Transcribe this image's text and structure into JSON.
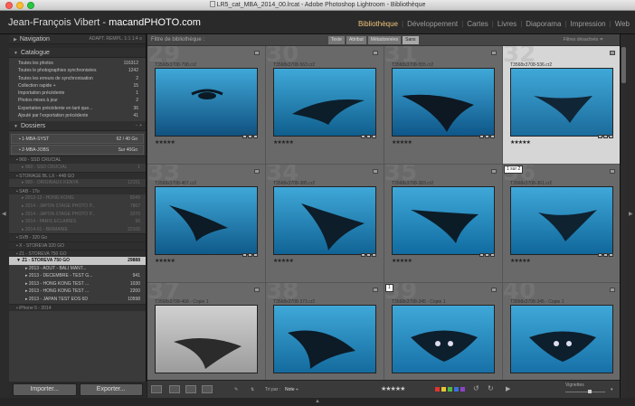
{
  "window": {
    "title": "LR5_cat_MBA_2014_00.lrcat - Adobe Photoshop Lightroom - Bibliothèque"
  },
  "identity": {
    "name": "Jean-François Vibert - ",
    "site": "macandPHOTO.com"
  },
  "modules": [
    {
      "label": "Bibliothèque",
      "active": true
    },
    {
      "label": "Développement"
    },
    {
      "label": "Cartes"
    },
    {
      "label": "Livres"
    },
    {
      "label": "Diaporama"
    },
    {
      "label": "Impression"
    },
    {
      "label": "Web"
    }
  ],
  "navigator": {
    "title": "Navigation",
    "options": "ADAPT.   REMPL.   1:1   1:4 ≡"
  },
  "catalog": {
    "title": "Catalogue",
    "items": [
      {
        "label": "Toutes les photos",
        "count": "116312"
      },
      {
        "label": "Toutes le photographies synchronisées",
        "count": "1242"
      },
      {
        "label": "Toutes les erreurs de synchronisation",
        "count": "2"
      },
      {
        "label": "Collection rapide +",
        "count": "15"
      },
      {
        "label": "Importation précédente",
        "count": "1"
      },
      {
        "label": "Photos mises à jour",
        "count": "2"
      },
      {
        "label": "Exportation précédente en tant que...",
        "count": "36"
      },
      {
        "label": "Ajouté par l'exportation précédente",
        "count": "41"
      }
    ]
  },
  "folders": {
    "title": "Dossiers",
    "rows": [
      {
        "label": "1-MBA-SYST",
        "count": "62 / 40 Go",
        "kind": "vol2"
      },
      {
        "label": "2-MBA-JOBS",
        "count": "Sur 40Go",
        "kind": "vol2"
      },
      {
        "label": "960 - SSD CRUCIAL",
        "count": "",
        "kind": "vol"
      },
      {
        "label": "960 - SSD CRUCIAL",
        "count": "1",
        "kind": "sub"
      },
      {
        "label": "STORAGE BL LX - 448 GO",
        "count": "",
        "kind": "vol"
      },
      {
        "label": "900 - ORIGINAUX KENYA",
        "count": "12151",
        "kind": "sub"
      },
      {
        "label": "SAB - 1To",
        "count": "",
        "kind": "vol"
      },
      {
        "label": "2013-12 - HONG KONG",
        "count": "8049",
        "kind": "sub"
      },
      {
        "label": "2014 - JAPON STAGE PHOTO P...",
        "count": "7867",
        "kind": "sub"
      },
      {
        "label": "2014 - JAPON STAGE PHOTO P...",
        "count": "3270",
        "kind": "sub"
      },
      {
        "label": "2014 - PARIS ECLAIRES",
        "count": "56",
        "kind": "sub"
      },
      {
        "label": "2014-01 - BIRMANIE",
        "count": "22100",
        "kind": "sub"
      },
      {
        "label": "SVB - 320 Go",
        "count": "",
        "kind": "vol"
      },
      {
        "label": "X - STOREVA 320 GO",
        "count": "",
        "kind": "vol"
      },
      {
        "label": "Z1 - STOREVA 750 GO",
        "count": "",
        "kind": "vol"
      },
      {
        "label": "Z1 - STOREVA 750 GO",
        "count": "29888",
        "kind": "sel"
      },
      {
        "label": "2013 - AOUT - BALI MANT...",
        "count": "",
        "kind": "act"
      },
      {
        "label": "2013 - DECEMBRE - TEST G...",
        "count": "941",
        "kind": "act"
      },
      {
        "label": "2013 - HONG KONG TEST ...",
        "count": "1030",
        "kind": "act"
      },
      {
        "label": "2013 - HONG KONG TEST ...",
        "count": "2200",
        "kind": "act"
      },
      {
        "label": "2013 - JAPAN TEST EOS 6D",
        "count": "10598",
        "kind": "act"
      },
      {
        "label": "iPhone 5 - 2014",
        "count": "",
        "kind": "vol"
      }
    ]
  },
  "buttons": {
    "import": "Importer...",
    "export": "Exporter..."
  },
  "filter": {
    "label": "Filtre de bibliothèque :",
    "options": [
      "Texte",
      "Attribut",
      "Métadonnées",
      "Sans"
    ],
    "presets": "Filtres désactivés ≑"
  },
  "cells": [
    {
      "num": "29",
      "file": "T3568x3708-798.cr2",
      "stars": "★★★★★",
      "sel": false,
      "copy": ""
    },
    {
      "num": "30",
      "file": "T3568x3708-563.cr2",
      "stars": "★★★★★",
      "sel": false,
      "copy": ""
    },
    {
      "num": "31",
      "file": "T3568x3708-555.cr2",
      "stars": "★★★★★",
      "sel": false,
      "copy": ""
    },
    {
      "num": "32",
      "file": "T3568x3708-536.cr2",
      "stars": "★★★★★",
      "sel": true,
      "copy": ""
    },
    {
      "num": "33",
      "file": "T3568x3708-467.cr2",
      "stars": "★★★★★",
      "sel": false,
      "copy": ""
    },
    {
      "num": "34",
      "file": "T3568x3708-385.cr2",
      "stars": "★★★★★",
      "sel": false,
      "copy": ""
    },
    {
      "num": "35",
      "file": "T3568x3708-383.cr2",
      "stars": "★★★★★",
      "sel": false,
      "copy": ""
    },
    {
      "num": "36",
      "file": "T3568x3708-361.cr2",
      "stars": "★★★★★",
      "sel": false,
      "copy": "1 sur 2"
    },
    {
      "num": "37",
      "file": "T3568x3708-468 - Copie 1",
      "stars": "",
      "sel": false,
      "copy": ""
    },
    {
      "num": "38",
      "file": "T3568x3708-373.cr2",
      "stars": "",
      "sel": false,
      "copy": ""
    },
    {
      "num": "39",
      "file": "T3568x3708-345 - Copie 1",
      "stars": "",
      "sel": false,
      "copy": "1"
    },
    {
      "num": "40",
      "file": "T3568x3708-345 - Copie 1",
      "stars": "",
      "sel": false,
      "copy": ""
    }
  ],
  "toolbar": {
    "sort_label": "Tri par :",
    "sort_value": "Note ÷",
    "stars": "★★★★★",
    "label_colors": [
      "#e0342e",
      "#e8c531",
      "#4fb848",
      "#3d6fd6",
      "#8a44c4"
    ],
    "thumb_label": "Vignettes"
  }
}
